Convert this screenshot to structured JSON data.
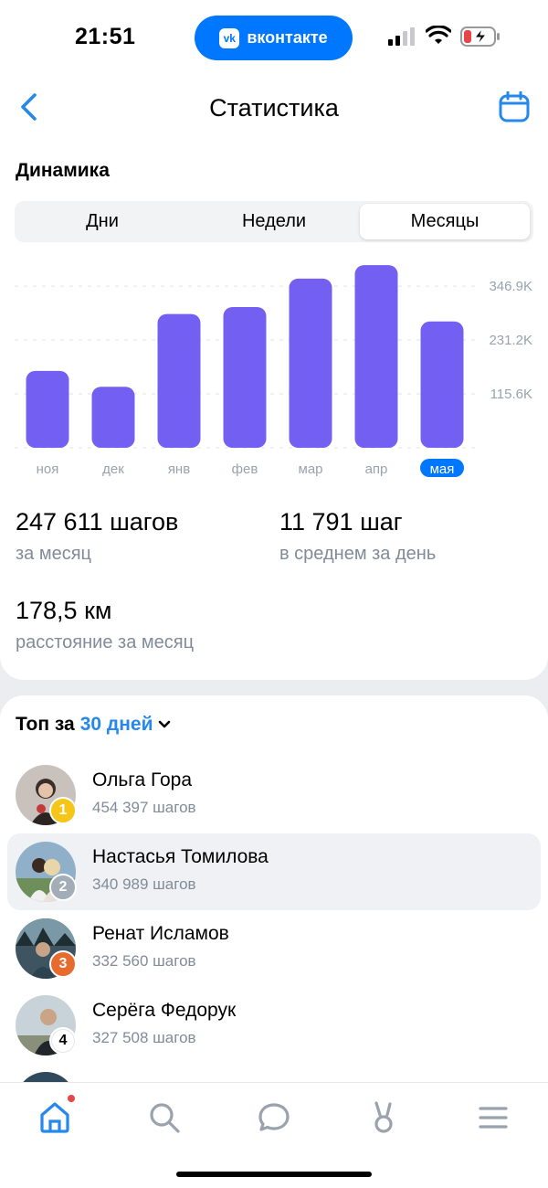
{
  "status_bar": {
    "time": "21:51",
    "app_pill": "вконтакте",
    "app_pill_logo": "vk"
  },
  "header": {
    "title": "Статистика",
    "back_icon": "chevron-left-icon",
    "calendar_icon": "calendar-icon"
  },
  "dynamics": {
    "title": "Динамика",
    "segments": [
      "Дни",
      "Недели",
      "Месяцы"
    ],
    "active_segment": "Месяцы"
  },
  "chart_data": {
    "type": "bar",
    "categories": [
      "ноя",
      "дек",
      "янв",
      "фев",
      "мар",
      "апр",
      "мая"
    ],
    "values": [
      165000,
      131000,
      287000,
      302000,
      363000,
      392000,
      271000
    ],
    "highlighted_category": "мая",
    "ytick_labels": [
      "346.9K",
      "231.2K",
      "115.6K"
    ],
    "yticks": [
      346900,
      231200,
      115600
    ],
    "ylim": [
      0,
      400000
    ],
    "bar_color": "#7360f2",
    "highlight_color": "#0077ff"
  },
  "stats": {
    "month_steps_value": "247 611 шагов",
    "month_steps_label": "за месяц",
    "avg_value": "11 791 шаг",
    "avg_label": "в среднем за день",
    "distance_value": "178,5 км",
    "distance_label": "расстояние за месяц"
  },
  "top": {
    "title": "Топ за",
    "period": "30 дней",
    "rows": [
      {
        "name": "Ольга Гора",
        "steps": "454 397 шагов",
        "rank": "1",
        "rank_color": "#f5c518",
        "avatar_bg": "#c9c2bc"
      },
      {
        "name": "Настасья Томилова",
        "steps": "340 989 шагов",
        "rank": "2",
        "rank_color": "#a3adb8",
        "avatar_bg": "#8fb0c8"
      },
      {
        "name": "Ренат Исламов",
        "steps": "332 560 шагов",
        "rank": "3",
        "rank_color": "#e86b2e",
        "avatar_bg": "#3e5561"
      },
      {
        "name": "Серёга Федорук",
        "steps": "327 508 шагов",
        "rank": "4",
        "rank_color": "#ffffff",
        "avatar_bg": "#9fb6bf"
      }
    ]
  },
  "tab_bar": {
    "items": [
      "home-icon",
      "search-icon",
      "messages-icon",
      "clips-icon",
      "menu-icon"
    ],
    "accent": "#2688eb"
  }
}
